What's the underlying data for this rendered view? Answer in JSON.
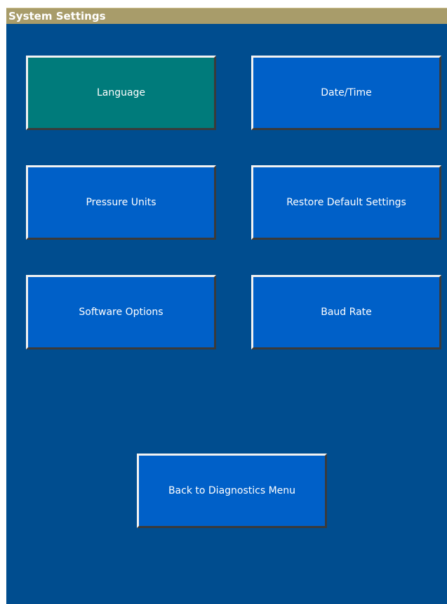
{
  "titlebar": {
    "title": "System Settings"
  },
  "buttons": {
    "language": {
      "label": "Language",
      "selected": true
    },
    "date_time": {
      "label": "Date/Time"
    },
    "pressure_units": {
      "label": "Pressure Units"
    },
    "restore_defaults": {
      "label": "Restore Default Settings"
    },
    "software_options": {
      "label": "Software Options"
    },
    "baud_rate": {
      "label": "Baud Rate"
    },
    "back": {
      "label": "Back to Diagnostics Menu"
    }
  },
  "colors": {
    "background": "#004d8f",
    "titlebar": "#a89c6a",
    "button": "#0060c8",
    "button_selected": "#007b7b",
    "text": "#ffffff"
  }
}
